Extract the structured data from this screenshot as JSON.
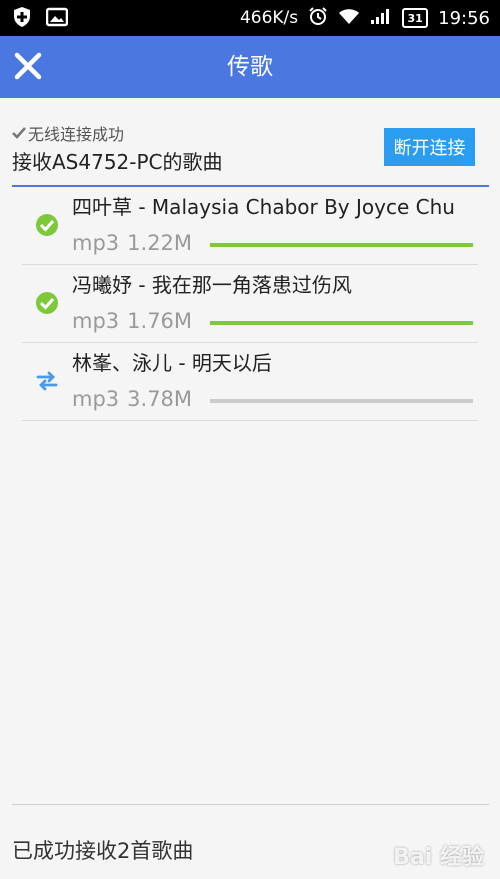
{
  "status_bar": {
    "speed": "466K/s",
    "battery": "31",
    "time": "19:56"
  },
  "app_bar": {
    "title": "传歌"
  },
  "connection": {
    "status": "无线连接成功",
    "title": "接收AS4752-PC的歌曲",
    "disconnect_label": "断开连接"
  },
  "songs": [
    {
      "name": "四叶草 - Malaysia Chabor By Joyce Chu",
      "format": "mp3",
      "size": "1.22M",
      "progress": 1.0,
      "state": "done"
    },
    {
      "name": "冯曦妤 - 我在那一角落患过伤风",
      "format": "mp3",
      "size": "1.76M",
      "progress": 1.0,
      "state": "done"
    },
    {
      "name": "林峯、泳儿 - 明天以后",
      "format": "mp3",
      "size": "3.78M",
      "progress": 0.0,
      "state": "transferring"
    }
  ],
  "footer": {
    "summary": "已成功接收2首歌曲",
    "watermark": "Bai 经验"
  },
  "colors": {
    "accent": "#4a78e0",
    "button": "#2a9df0",
    "success": "#7dc93a",
    "transfer": "#4a9ae8"
  }
}
